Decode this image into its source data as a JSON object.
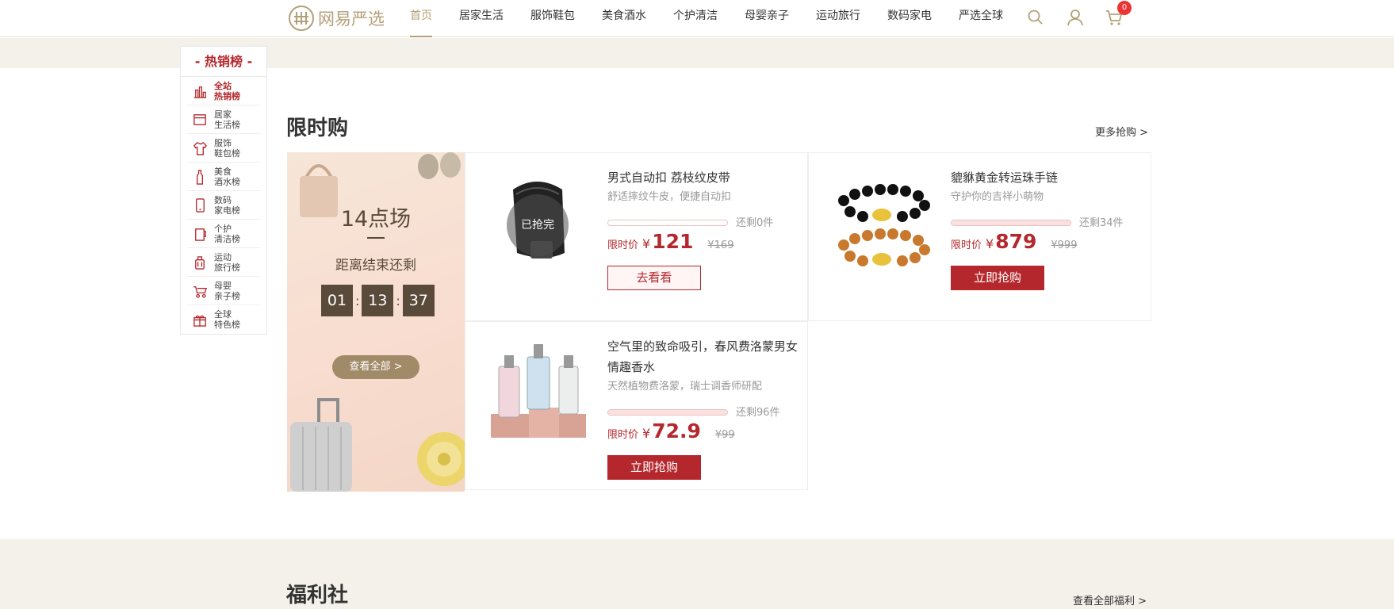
{
  "header": {
    "logo_text": "网易严选",
    "nav": [
      "首页",
      "居家生活",
      "服饰鞋包",
      "美食酒水",
      "个护清洁",
      "母婴亲子",
      "运动旅行",
      "数码家电",
      "严选全球"
    ],
    "active_nav_index": 0,
    "cart_count": "0",
    "icons": [
      "search-icon",
      "user-icon",
      "cart-icon"
    ]
  },
  "rank": {
    "title": "- 热销榜 -",
    "items": [
      {
        "label": "全站热销榜",
        "l1": "全站",
        "l2": "热销榜",
        "icon": "chart-icon",
        "active": true
      },
      {
        "label": "居家生活榜",
        "l1": "居家",
        "l2": "生活榜",
        "icon": "home-icon"
      },
      {
        "label": "服饰鞋包榜",
        "l1": "服饰",
        "l2": "鞋包榜",
        "icon": "clothes-icon"
      },
      {
        "label": "美食酒水榜",
        "l1": "美食",
        "l2": "酒水榜",
        "icon": "bottle-icon"
      },
      {
        "label": "数码家电榜",
        "l1": "数码",
        "l2": "家电榜",
        "icon": "phone-icon"
      },
      {
        "label": "个护清洁榜",
        "l1": "个护",
        "l2": "清洁榜",
        "icon": "cup-icon"
      },
      {
        "label": "运动旅行榜",
        "l1": "运动",
        "l2": "旅行榜",
        "icon": "luggage-icon"
      },
      {
        "label": "母婴亲子榜",
        "l1": "母婴",
        "l2": "亲子榜",
        "icon": "stroller-icon"
      },
      {
        "label": "全球特色榜",
        "l1": "全球",
        "l2": "特色榜",
        "icon": "gift-icon"
      }
    ]
  },
  "flash": {
    "title": "限时购",
    "more": "更多抢购 >",
    "session": "14点场",
    "countdown_label": "距离结束还剩",
    "hours": "01",
    "minutes": "13",
    "seconds": "37",
    "view_all": "查看全部 >"
  },
  "products": [
    {
      "name": "男式自动扣 荔枝纹皮带",
      "desc": "舒适摔纹牛皮，便捷自动扣",
      "remain": "还剩0件",
      "progress": 0.0,
      "price_label": "限时价",
      "currency": "¥",
      "price": "121",
      "old_price": "¥169",
      "button": "去看看",
      "sold_out": "已抢完",
      "image": "belt-image"
    },
    {
      "name": "貔貅黄金转运珠手链",
      "desc": "守护你的吉祥小萌物",
      "remain": "还剩34件",
      "progress": 1.0,
      "price_label": "限时价",
      "currency": "¥",
      "price": "879",
      "old_price": "¥999",
      "button": "立即抢购",
      "image": "bracelet-image"
    },
    {
      "name": "空气里的致命吸引，春风费洛蒙男女情趣香水",
      "desc": "天然植物费洛蒙，瑞士调香师研配",
      "remain": "还剩96件",
      "progress": 1.0,
      "price_label": "限时价",
      "currency": "¥",
      "price": "72.9",
      "old_price": "¥99",
      "button": "立即抢购",
      "image": "perfume-image"
    }
  ],
  "welfare": {
    "title": "福利社",
    "more": "查看全部福利 >"
  },
  "colors": {
    "brand_red": "#b4282d",
    "gold": "#b4a078",
    "beige": "#f4f0ea"
  }
}
